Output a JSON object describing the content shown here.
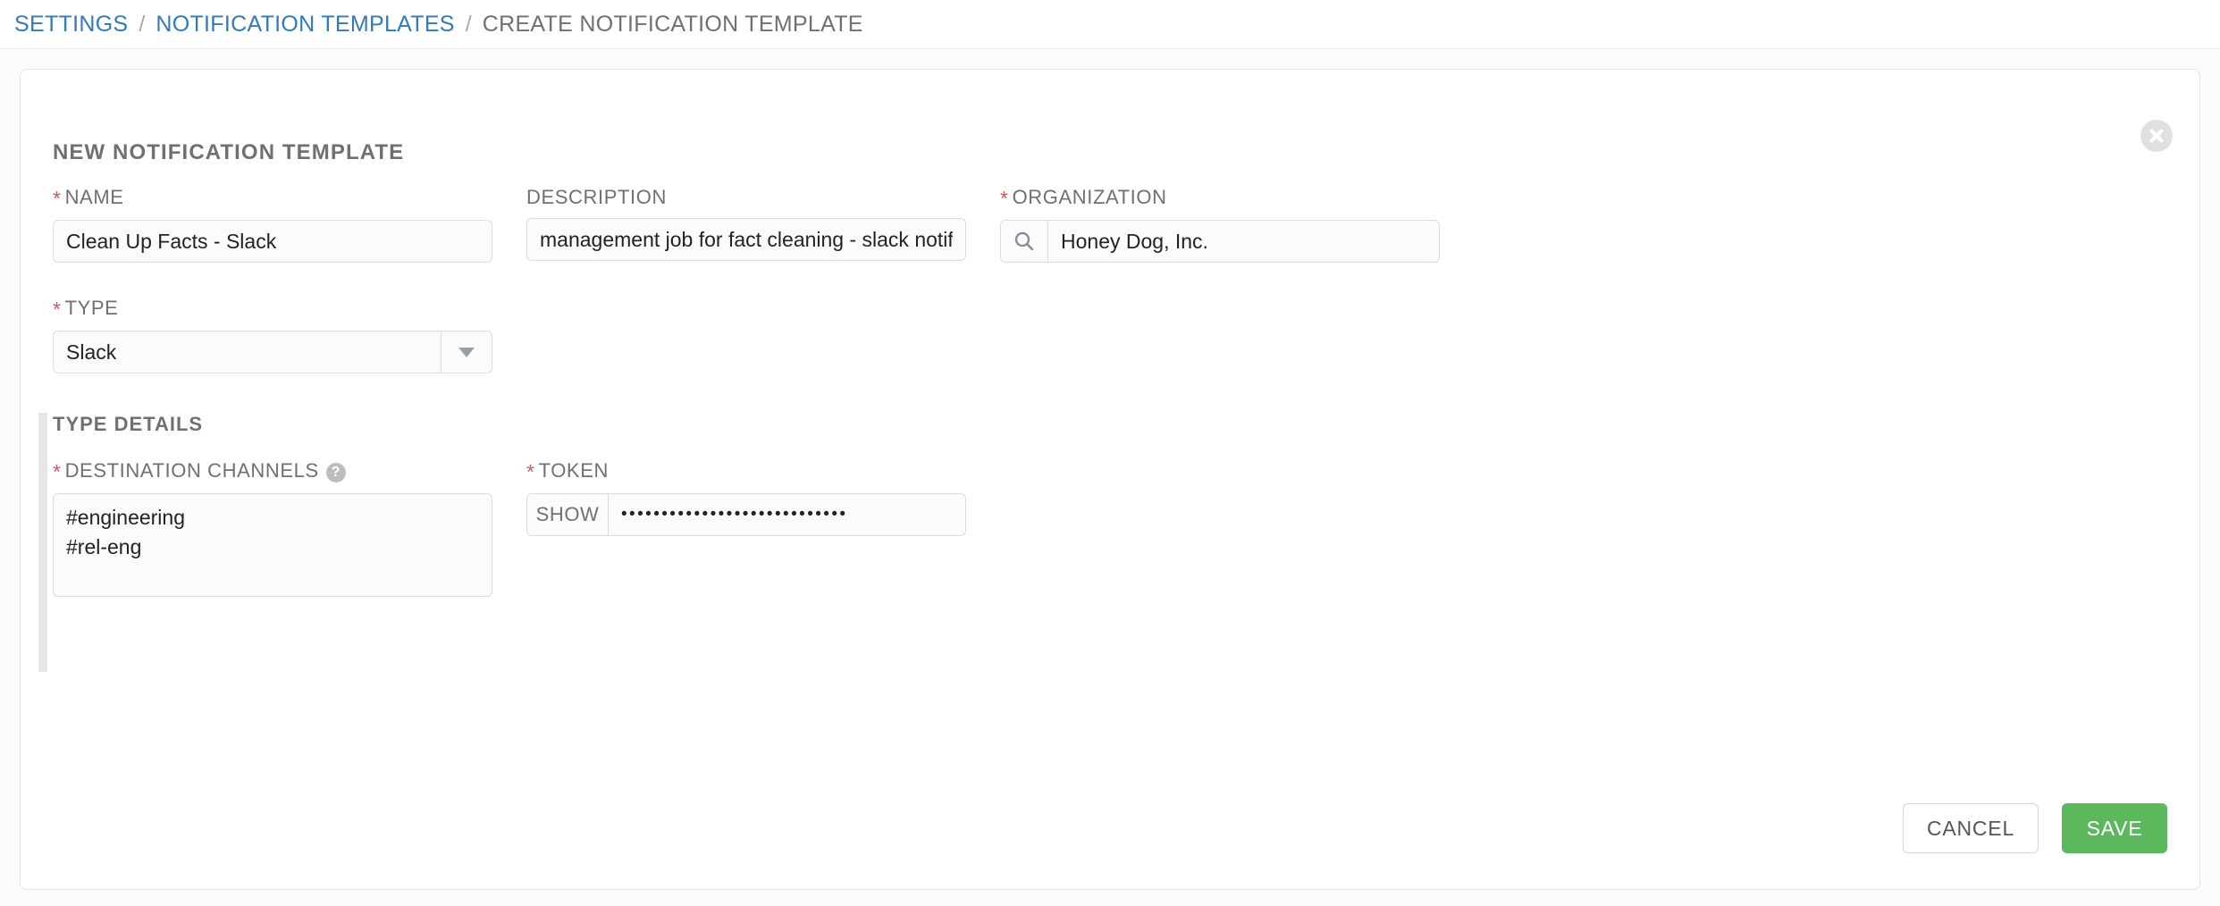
{
  "breadcrumb": {
    "items": [
      {
        "label": "SETTINGS",
        "current": false
      },
      {
        "label": "NOTIFICATION TEMPLATES",
        "current": false
      },
      {
        "label": "CREATE NOTIFICATION TEMPLATE",
        "current": true
      }
    ],
    "separator": "/"
  },
  "card": {
    "title": "NEW NOTIFICATION TEMPLATE",
    "close_icon": "close-circle-icon"
  },
  "form": {
    "name": {
      "label": "NAME",
      "required": true,
      "required_marker": "*",
      "value": "Clean Up Facts - Slack",
      "placeholder": ""
    },
    "description": {
      "label": "DESCRIPTION",
      "required": false,
      "value": "management job for fact cleaning - slack notification",
      "placeholder": ""
    },
    "organization": {
      "label": "ORGANIZATION",
      "required": true,
      "required_marker": "*",
      "value": "Honey Dog, Inc.",
      "placeholder": "",
      "addon_icon": "search-icon"
    },
    "type": {
      "label": "TYPE",
      "required": true,
      "required_marker": "*",
      "value": "Slack",
      "arrow_icon": "chevron-down-icon"
    }
  },
  "type_details": {
    "title": "TYPE DETAILS",
    "destination_channels": {
      "label": "DESTINATION CHANNELS",
      "required": true,
      "required_marker": "*",
      "help_icon": "question-mark-icon",
      "help_glyph": "?",
      "value": "#engineering\n#rel-eng",
      "placeholder": ""
    },
    "token": {
      "label": "TOKEN",
      "required": true,
      "required_marker": "*",
      "show_button_label": "SHOW",
      "masked_value": "••••••••••••••••••••••••••••",
      "placeholder": ""
    }
  },
  "footer": {
    "cancel_label": "CANCEL",
    "save_label": "SAVE"
  },
  "colors": {
    "link": "#337ab7",
    "required": "#d9534f",
    "save_green": "#5cb85c",
    "label_gray": "#707070",
    "border": "#dcdcdc"
  }
}
